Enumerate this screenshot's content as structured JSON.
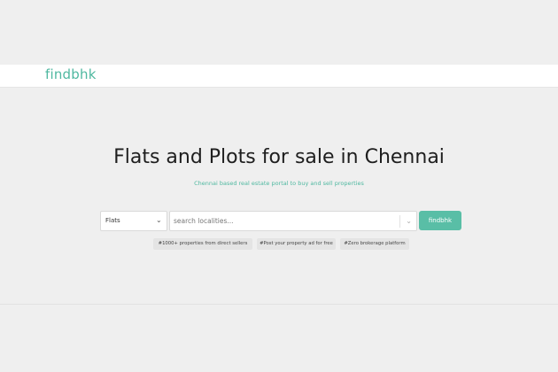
{
  "navbar": {
    "logo_text": "findbhk"
  },
  "hero": {
    "title": "Flats and Plots for sale in Chennai",
    "subtitle": "Chennai based real estate portal to buy and sell properties"
  },
  "search": {
    "type_selected": "Flats",
    "locality_placeholder": "search localities...",
    "button_label": "findbhk"
  },
  "tags": [
    "#1000+ properties from direct sellers",
    "#Post your property ad for free",
    "#Zero brokerage platform"
  ],
  "colors": {
    "brand": "#4fb8a0",
    "button": "#59bea6",
    "background": "#efefef"
  },
  "icons": {
    "select_chevron": "chevron-down-icon",
    "input_chevron": "chevron-down-icon"
  }
}
